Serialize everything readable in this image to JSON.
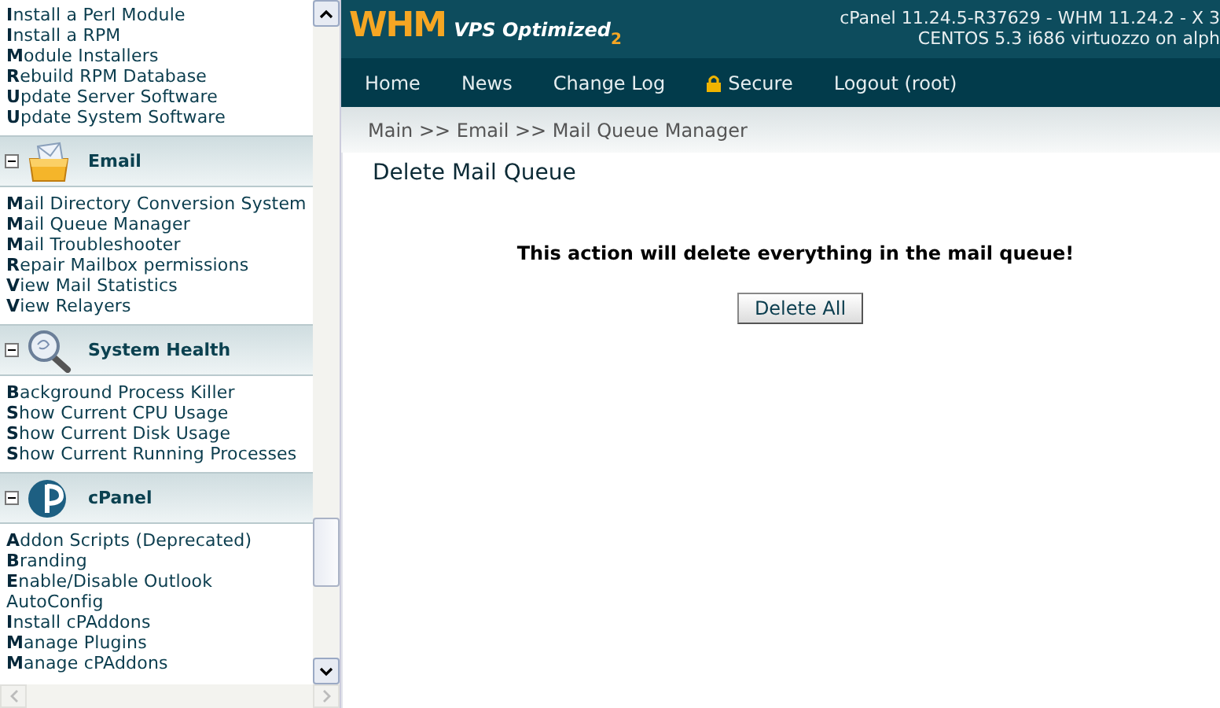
{
  "sidebar": {
    "sections": [
      {
        "items": [
          "**I**nstall a Perl Module",
          "**I**nstall a RPM",
          "**M**odule Installers",
          "**R**ebuild RPM Database",
          "**U**pdate Server Software",
          "**U**pdate System Software"
        ]
      },
      {
        "title": "Email",
        "kind": "mail",
        "expanded": true,
        "items": [
          "**M**ail Directory Conversion System",
          "**M**ail Queue Manager",
          "**M**ail Troubleshooter",
          "**R**epair Mailbox permissions",
          "**V**iew Mail Statistics",
          "**V**iew Relayers"
        ]
      },
      {
        "title": "System Health",
        "kind": "magnifier",
        "expanded": true,
        "items": [
          "**B**ackground Process Killer",
          "**S**how Current CPU Usage",
          "**S**how Current Disk Usage",
          "**S**how Current Running Processes"
        ]
      },
      {
        "title": "cPanel",
        "kind": "cpanel",
        "expanded": true,
        "items": [
          "**A**ddon Scripts (Deprecated)",
          "**B**randing",
          "**E**nable/Disable Outlook",
          "AutoConfig",
          "**I**nstall cPAddons",
          "**M**anage Plugins",
          "**M**anage cPAddons"
        ]
      }
    ]
  },
  "header": {
    "brand": "WHM",
    "product": "VPS Optimized",
    "edition": "2",
    "version": "cPanel 11.24.5-R37629 - WHM 11.24.2 - X 3",
    "system": "CENTOS 5.3 i686 virtuozzo on alph"
  },
  "nav": [
    {
      "label": "Home"
    },
    {
      "label": "News"
    },
    {
      "label": "Change Log"
    },
    {
      "label": "Secure",
      "kind": "lock"
    },
    {
      "label": "Logout (root)"
    }
  ],
  "breadcrumb": "Main >> Email >> Mail Queue Manager",
  "page": {
    "title": "Delete Mail Queue",
    "warning": "This action will delete everything in the mail queue!",
    "button": "Delete All"
  }
}
